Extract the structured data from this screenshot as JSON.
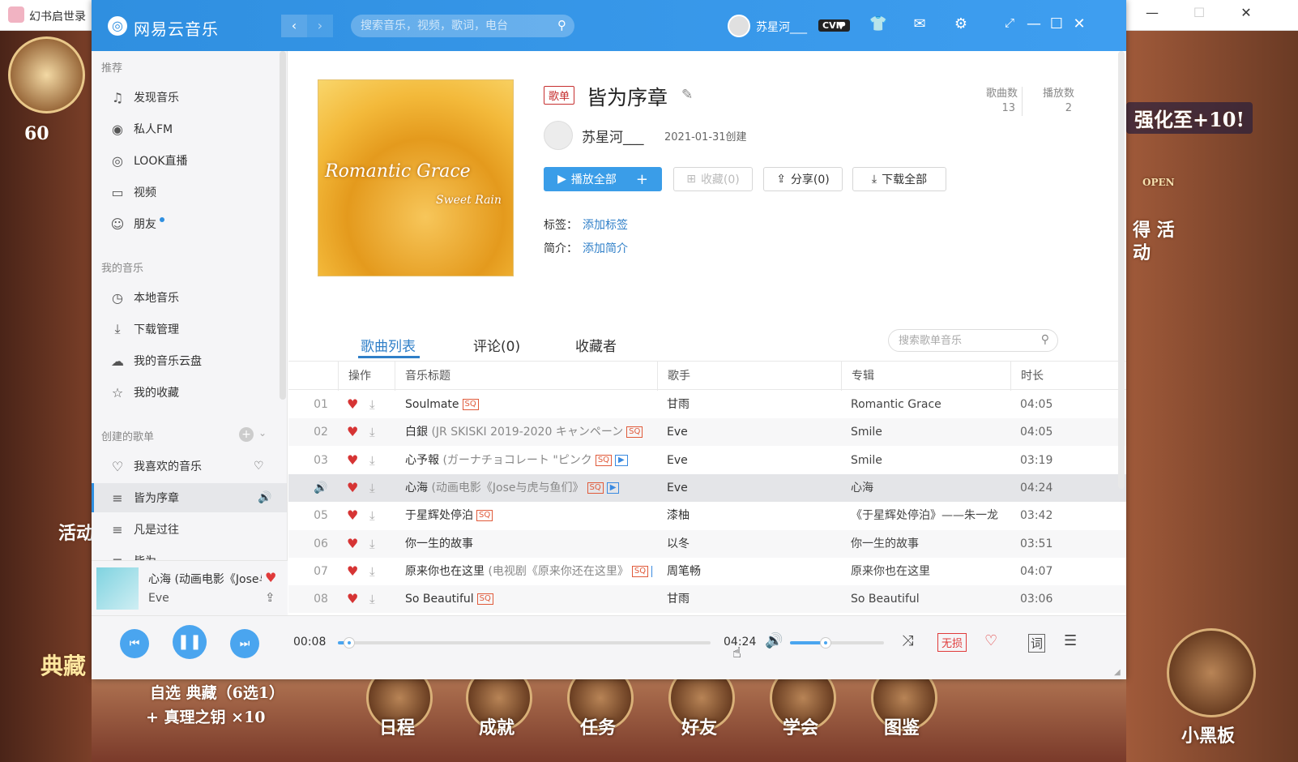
{
  "game": {
    "window_title": "幻书启世录",
    "level": "60",
    "banner": "强化至+10!",
    "open_sign": "OPEN",
    "left_text": "活动",
    "right_event": "得 活动",
    "bottom_left_title": "典藏",
    "bottom_left_line1": "自选 典藏（6选1）",
    "bottom_left_line2": "+ 真理之钥 ×10",
    "bottom_icons": [
      "日程",
      "成就",
      "任务",
      "好友",
      "学会",
      "图鉴"
    ],
    "blackboard": "小黑板"
  },
  "app": {
    "name": "网易云音乐",
    "search_placeholder": "搜索音乐，视频，歌词，电台",
    "username": "苏星河___",
    "vip_label": "CVIP"
  },
  "sidebar": {
    "section_recommend": "推荐",
    "recommend": [
      {
        "icon": "music-note-icon",
        "label": "发现音乐"
      },
      {
        "icon": "radio-icon",
        "label": "私人FM"
      },
      {
        "icon": "live-icon",
        "label": "LOOK直播"
      },
      {
        "icon": "video-icon",
        "label": "视频"
      },
      {
        "icon": "friends-icon",
        "label": "朋友"
      }
    ],
    "section_my": "我的音乐",
    "my": [
      {
        "icon": "local-music-icon",
        "label": "本地音乐"
      },
      {
        "icon": "download-icon",
        "label": "下载管理"
      },
      {
        "icon": "cloud-icon",
        "label": "我的音乐云盘"
      },
      {
        "icon": "favorite-icon",
        "label": "我的收藏"
      }
    ],
    "section_created": "创建的歌单",
    "created": [
      {
        "icon": "heart-outline-icon",
        "label": "我喜欢的音乐"
      },
      {
        "icon": "playlist-icon",
        "label": "皆为序章"
      },
      {
        "icon": "playlist-icon",
        "label": "凡是过往"
      },
      {
        "icon": "playlist-icon",
        "label": "皆为"
      }
    ]
  },
  "now_playing": {
    "title": "心海 (动画电影《Jose与虎与鱼们》中文主题曲)",
    "artist": "Eve"
  },
  "playlist": {
    "badge": "歌单",
    "title": "皆为序章",
    "creator": "苏星河___",
    "created": "2021-01-31创建",
    "stats": [
      {
        "label": "歌曲数",
        "value": "13"
      },
      {
        "label": "播放数",
        "value": "2"
      }
    ],
    "cover_title": "Romantic Grace",
    "cover_subtitle": "Sweet Rain",
    "buttons": {
      "play_all": "播放全部",
      "add": "+",
      "collect": "收藏(0)",
      "share": "分享(0)",
      "download_all": "下载全部"
    },
    "tags_label": "标签：",
    "tags_value": "添加标签",
    "intro_label": "简介：",
    "intro_value": "添加简介"
  },
  "tabs": [
    "歌曲列表",
    "评论(0)",
    "收藏者"
  ],
  "table_search_placeholder": "搜索歌单音乐",
  "table": {
    "headers": [
      "操作",
      "音乐标题",
      "歌手",
      "专辑",
      "时长"
    ],
    "rows": [
      {
        "num": "01",
        "title": "Soulmate",
        "sub": "",
        "sq": true,
        "mv": false,
        "artist": "甘雨",
        "album": "Romantic Grace",
        "duration": "04:05"
      },
      {
        "num": "02",
        "title": "白銀",
        "sub": "(JR SKISKI 2019-2020 キャンペーン",
        "sq": true,
        "mv": false,
        "artist": "Eve",
        "album": "Smile",
        "duration": "04:05"
      },
      {
        "num": "03",
        "title": "心予報",
        "sub": "(ガーナチョコレート \"ピンク",
        "sq": true,
        "mv": true,
        "artist": "Eve",
        "album": "Smile",
        "duration": "03:19"
      },
      {
        "num": "",
        "title": "心海",
        "sub": "(动画电影《Jose与虎与鱼们》",
        "sq": true,
        "mv": true,
        "artist": "Eve",
        "album": "心海",
        "duration": "04:24"
      },
      {
        "num": "05",
        "title": "于星辉处停泊",
        "sub": "",
        "sq": true,
        "mv": false,
        "artist": "漆柚",
        "album": "《于星辉处停泊》——朱一龙",
        "duration": "03:42"
      },
      {
        "num": "06",
        "title": "你一生的故事",
        "sub": "",
        "sq": false,
        "mv": false,
        "artist": "以冬",
        "album": "你一生的故事",
        "duration": "03:51"
      },
      {
        "num": "07",
        "title": "原来你也在这里",
        "sub": "(电视剧《原来你还在这里》",
        "sq": true,
        "mv": true,
        "artist": "周笔畅",
        "album": "原来你也在这里",
        "duration": "04:07"
      },
      {
        "num": "08",
        "title": "So Beautiful",
        "sub": "",
        "sq": true,
        "mv": false,
        "artist": "甘雨",
        "album": "So Beautiful",
        "duration": "03:06"
      }
    ]
  },
  "player": {
    "current_time": "00:08",
    "total_time": "04:24",
    "progress": 0.03,
    "volume": 0.38,
    "quality": "无损",
    "lyrics": "词"
  }
}
